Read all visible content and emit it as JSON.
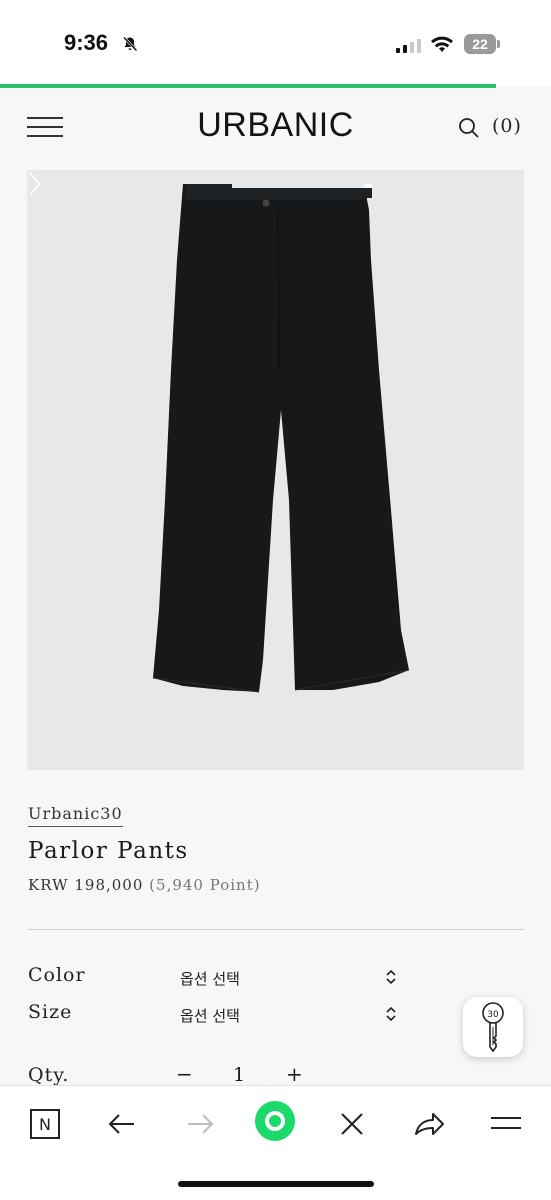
{
  "status_bar": {
    "time": "9:36",
    "battery_level": "22"
  },
  "page_load_progress": 0.9,
  "header": {
    "logo": "URBANIC",
    "cart_count": "(0)"
  },
  "product": {
    "brand": "Urbanic30",
    "name": "Parlor Pants",
    "price": "KRW 198,000",
    "points": "(5,940 Point)"
  },
  "options": {
    "color_label": "Color",
    "color_value": "옵션 선택",
    "size_label": "Size",
    "size_value": "옵션 선택",
    "qty_label": "Qty.",
    "qty_minus": "−",
    "qty_value": "1",
    "qty_plus": "+"
  },
  "floating_badge": {
    "label": "30"
  },
  "browser_toolbar": {
    "home_label": "N",
    "accent_color": "#1bd96a"
  }
}
